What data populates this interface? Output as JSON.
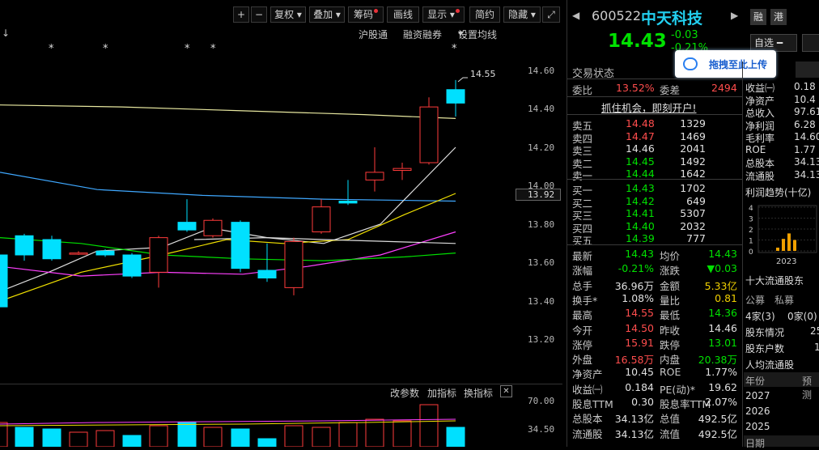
{
  "toolbar": {
    "plus": "+",
    "minus": "−",
    "fuquan": "复权",
    "diejia": "叠加",
    "chouma": "筹码",
    "huaxian": "画线",
    "xianshi": "显示",
    "jieyue": "简约",
    "yincang": "隐藏",
    "expand_icon": "expand-icon"
  },
  "subnav": {
    "arrow": "↓",
    "hugutong": "沪股通",
    "rongzi": "融资融券",
    "shezhi": "设置均线"
  },
  "chart_marks": {
    "star": "*",
    "high_label": "14.55",
    "cursor_price": "13.92"
  },
  "price_axis": [
    "14.60",
    "14.40",
    "14.20",
    "14.00",
    "13.80",
    "13.60",
    "13.40",
    "13.20"
  ],
  "volume_axis": [
    "70.00",
    "34.50"
  ],
  "indicator_bar": {
    "params": "改参数",
    "add": "加指标",
    "switch": "换指标",
    "close": "✕"
  },
  "colors": {
    "up": "#ff3b3b",
    "down": "#00e0ff",
    "ma5": "#e0e0e0",
    "ma10": "#f0e000",
    "ma20": "#ff40ff",
    "ma30": "#00e000",
    "ma60": "#3fa8ff",
    "ma120": "#e8e8a0"
  },
  "stock": {
    "code": "600522",
    "name": "中天科技",
    "price": "14.43",
    "change": "-0.03",
    "change_pct": "-0.21%",
    "rong": "融",
    "gang": "港",
    "zixuan": "自选",
    "upload_btn": "拖拽至此上传",
    "trade_status": "交易状态"
  },
  "weibi": {
    "l1": "委比",
    "v1": "13.52%",
    "l2": "委差",
    "v2": "2494"
  },
  "banner": "抓住机会，即刻开户!",
  "asks": [
    {
      "label": "卖五",
      "price": "14.48",
      "vol": "1329"
    },
    {
      "label": "卖四",
      "price": "14.47",
      "vol": "1469"
    },
    {
      "label": "卖三",
      "price": "14.46",
      "vol": "2041"
    },
    {
      "label": "卖二",
      "price": "14.45",
      "vol": "1492"
    },
    {
      "label": "卖一",
      "price": "14.44",
      "vol": "1642"
    }
  ],
  "bids": [
    {
      "label": "买一",
      "price": "14.43",
      "vol": "1702"
    },
    {
      "label": "买二",
      "price": "14.42",
      "vol": "649"
    },
    {
      "label": "买三",
      "price": "14.41",
      "vol": "5307"
    },
    {
      "label": "买四",
      "price": "14.40",
      "vol": "2032"
    },
    {
      "label": "买五",
      "price": "14.39",
      "vol": "777"
    }
  ],
  "stats": [
    {
      "l1": "最新",
      "v1": "14.43",
      "c1": "green",
      "l2": "均价",
      "v2": "14.43",
      "c2": "green"
    },
    {
      "l1": "涨幅",
      "v1": "-0.21%",
      "c1": "green",
      "l2": "涨跌",
      "v2": "▼0.03",
      "c2": "green"
    },
    {
      "l1": "总手",
      "v1": "36.96万",
      "c1": "white",
      "l2": "金额",
      "v2": "5.33亿",
      "c2": "yellow"
    },
    {
      "l1": "换手*",
      "v1": "1.08%",
      "c1": "white",
      "l2": "量比",
      "v2": "0.81",
      "c2": "yellow"
    },
    {
      "l1": "最高",
      "v1": "14.55",
      "c1": "red",
      "l2": "最低",
      "v2": "14.36",
      "c2": "green"
    },
    {
      "l1": "今开",
      "v1": "14.50",
      "c1": "red",
      "l2": "昨收",
      "v2": "14.46",
      "c2": "white"
    },
    {
      "l1": "涨停",
      "v1": "15.91",
      "c1": "red",
      "l2": "跌停",
      "v2": "13.01",
      "c2": "green"
    },
    {
      "l1": "外盘",
      "v1": "16.58万",
      "c1": "red",
      "l2": "内盘",
      "v2": "20.38万",
      "c2": "green"
    },
    {
      "l1": "净资产",
      "v1": "10.45",
      "c1": "white",
      "l2": "ROE",
      "v2": "1.77%",
      "c2": "white"
    },
    {
      "l1": "收益㈠",
      "v1": "0.184",
      "c1": "white",
      "l2": "PE(动)*",
      "v2": "19.62",
      "c2": "white"
    },
    {
      "l1": "股息TTM",
      "v1": "0.30",
      "c1": "white",
      "l2": "股息率TTM",
      "v2": "2.07%",
      "c2": "white"
    },
    {
      "l1": "总股本",
      "v1": "34.13亿",
      "c1": "white",
      "l2": "总值",
      "v2": "492.5亿",
      "c2": "white"
    },
    {
      "l1": "流通股",
      "v1": "34.13亿",
      "c1": "white",
      "l2": "流值",
      "v2": "492.5亿",
      "c2": "white"
    }
  ],
  "fin": [
    {
      "l": "收益㈠",
      "v": "0.18"
    },
    {
      "l": "净资产",
      "v": "10.4"
    },
    {
      "l": "总收入",
      "v": "97.61"
    },
    {
      "l": "净利润",
      "v": "6.28"
    },
    {
      "l": "毛利率",
      "v": "14.60"
    },
    {
      "l": "ROE",
      "v": "1.77"
    },
    {
      "l": "总股本",
      "v": "34.13"
    },
    {
      "l": "流通股",
      "v": "34.13"
    }
  ],
  "profit_trend": {
    "title": "利润趋势(十亿)",
    "y": [
      "4",
      "3",
      "2",
      "1",
      "0"
    ],
    "year": "2023",
    "bars": [
      0.3,
      1.1,
      1.6,
      1.0
    ]
  },
  "holders": {
    "title": "十大流通股东",
    "tab1": "公募",
    "tab2": "私募",
    "row1": "4家(3)",
    "row1b": "0家(0)",
    "i1": "股东情况",
    "i1v": "25",
    "i2": "股东户数",
    "i2v": "1",
    "i3": "人均流通股"
  },
  "forecast": {
    "h1": "年份",
    "h2": "预测",
    "years": [
      "2027",
      "2026",
      "2025"
    ],
    "last": "日期"
  }
}
